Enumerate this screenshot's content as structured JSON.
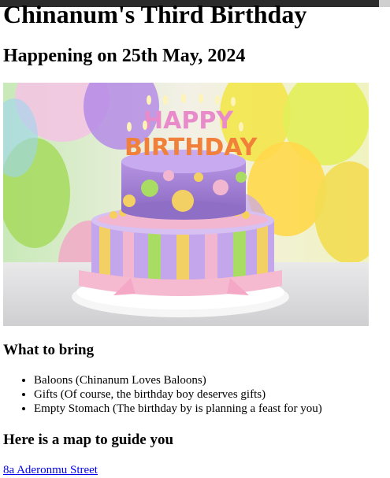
{
  "page": {
    "title": "Chinanum's Third Birthday",
    "subtitle": "Happening on 25th May, 2024"
  },
  "hero": {
    "cake_text_line1": "HAPPY",
    "cake_text_line2": "BIRTHDAY"
  },
  "bring": {
    "heading": "What to bring",
    "items": [
      "Baloons (Chinanum Loves Baloons)",
      "Gifts (Of course, the birthday boy deserves gifts)",
      "Empty Stomach (The birthday by is planning a feast for you)"
    ]
  },
  "map": {
    "heading": "Here is a map to guide you",
    "link_text": "8a Aderonmu Street"
  }
}
